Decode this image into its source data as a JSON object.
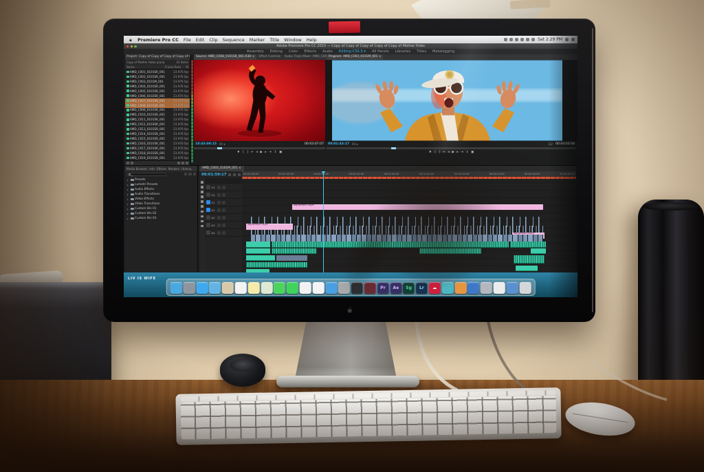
{
  "glyphs": {
    "close": "×",
    "caret": "▾"
  },
  "wallpaper": {
    "text": "LIV IS WIFE"
  },
  "menu_bar": {
    "app_name": "Premiere Pro CC",
    "items": [
      "File",
      "Edit",
      "Clip",
      "Sequence",
      "Marker",
      "Title",
      "Window",
      "Help"
    ],
    "status_icons": [
      "notification-center-icon",
      "bluetooth-icon",
      "airplay-icon",
      "battery-icon",
      "wifi-icon",
      "volume-icon"
    ],
    "clock": "Sat 2:29 PM"
  },
  "window_title": "Adobe Premiere Pro CC 2015 — Copy of Copy of Copy of Copy of Copy of Mother Hobo",
  "workspaces": {
    "tabs": [
      {
        "label": "Assembly"
      },
      {
        "label": "Editing"
      },
      {
        "label": "Color"
      },
      {
        "label": "Effects"
      },
      {
        "label": "Audio"
      },
      {
        "label": "Editing CS5.5 ▾",
        "color": "#35b3e8"
      },
      {
        "label": "All Panels"
      },
      {
        "label": "Libraries"
      },
      {
        "label": "Titles"
      },
      {
        "label": "Metalogging"
      }
    ]
  },
  "project_panel": {
    "tab": "Project: Copy of Copy of Copy of Copy of Copy of Mother Hobo",
    "path": "Copy of Mother Hobo.prproj",
    "item_count": "41 Items",
    "columns": [
      "Name",
      "Frame Rate",
      "M"
    ],
    "rows": [
      {
        "name": "AMD_C001_0101SR_001",
        "fps": "23.976 fps"
      },
      {
        "name": "AMD_C002_0101SR_001",
        "fps": "23.976 fps"
      },
      {
        "name": "AMD_C003_0101M_001",
        "fps": "23.976 fps"
      },
      {
        "name": "AMD_C004_0101SR_001",
        "fps": "23.976 fps"
      },
      {
        "name": "AMD_C005_0101SR_001",
        "fps": "23.976 fps"
      },
      {
        "name": "AMD_C006_0102SR_001",
        "fps": "23.976 fps"
      },
      {
        "name": "AMD_C007_0101SR_001",
        "fps": "23.976 fps",
        "bg": "#a8693a"
      },
      {
        "name": "AMD_C008_0101SR_001",
        "fps": "23.976 fps",
        "bg": "#a8693a"
      },
      {
        "name": "AMD_C009_0101SR_001",
        "fps": "23.976 fps"
      },
      {
        "name": "AMD_C010_0101SR_001",
        "fps": "23.976 fps"
      },
      {
        "name": "AMD_C011_0101SR_001",
        "fps": "23.976 fps"
      },
      {
        "name": "AMD_C012_0103SR_001",
        "fps": "23.976 fps"
      },
      {
        "name": "AMD_C013_0101SR_001",
        "fps": "23.976 fps"
      },
      {
        "name": "AMD_C014_0101SR_001",
        "fps": "23.976 fps"
      },
      {
        "name": "AMD_C015_0101SR_001",
        "fps": "23.976 fps"
      },
      {
        "name": "AMD_C016_0101SR_001",
        "fps": "23.976 fps"
      },
      {
        "name": "AMD_C017_0101SR_001",
        "fps": "23.976 fps"
      },
      {
        "name": "AMD_C018_0101SR_001",
        "fps": "23.976 fps"
      },
      {
        "name": "AMD_C019_0101SR_001",
        "fps": "23.976 fps"
      }
    ]
  },
  "source_monitor": {
    "tab": "Source: AMD_C008_0101SR_001.R3D ×",
    "tab_effects": "Effect Controls",
    "tab_mixer": "Audio Track Mixer: AMD_C003_01",
    "timecode_left": "18:43:08:15",
    "fit": "Fit ▾",
    "timecode_right": "00:03:07:07"
  },
  "program_monitor": {
    "tab": "Program: AMD_C003_0101M_001 ×",
    "timecode_left": "00:01:43:17",
    "fit": "Fit ▾",
    "half": "1/2",
    "timecode_right": "00:04:03:08"
  },
  "transport": {
    "buttons": [
      {
        "glyph": "♦",
        "name": "add-marker-button"
      },
      {
        "glyph": "{",
        "name": "mark-in-button"
      },
      {
        "glyph": "}",
        "name": "mark-out-button"
      },
      {
        "glyph": "⇤",
        "name": "go-to-in-button"
      },
      {
        "glyph": "◂",
        "name": "step-back-button"
      },
      {
        "glyph": "▶",
        "name": "play-button"
      },
      {
        "glyph": "▸",
        "name": "step-forward-button"
      },
      {
        "glyph": "⇥",
        "name": "go-to-out-button"
      },
      {
        "glyph": "↥",
        "name": "lift-button"
      },
      {
        "glyph": "▣",
        "name": "export-frame-button"
      }
    ]
  },
  "bin_panel": {
    "tabs": [
      "Media Browser",
      "Info",
      "Effects",
      "Markers",
      "History"
    ],
    "items": [
      "Presets",
      "Lumetri Presets",
      "Audio Effects",
      "Audio Transitions",
      "Video Effects",
      "Video Transitions",
      "Custom Bin 01",
      "Custom Bin 02",
      "Custom Bin 03"
    ]
  },
  "timeline": {
    "tab": "AMD_C003_0101M_001 ×",
    "timecode": "00:01:59:17",
    "ruler_labels": [
      "00:01:30:00",
      "00:01:45:00",
      "00:02:00:00",
      "00:02:15:00",
      "00:02:30:00",
      "00:02:45:00",
      "00:03:00:00",
      "00:03:15:00",
      "00:03:30:00",
      "00:03:45:00"
    ],
    "adjustment_label": "Adjustment Layer",
    "tools": [
      "selection-tool",
      "track-select-tool",
      "ripple-edit-tool",
      "rolling-edit-tool",
      "rate-stretch-tool",
      "razor-tool",
      "slip-tool",
      "pen-tool",
      "hand-tool",
      "zoom-tool"
    ],
    "tracks": [
      {
        "label": "V3",
        "tbg": "#3f3f3f"
      },
      {
        "label": "V2",
        "tbg": "#3f3f3f"
      },
      {
        "label": "V1",
        "tbg": "#2d8ceb"
      },
      {
        "label": "A1",
        "tbg": "#2d8ceb"
      },
      {
        "label": "A2",
        "tbg": "#3f3f3f"
      },
      {
        "label": "A3",
        "tbg": "#3f3f3f"
      },
      {
        "label": "A4",
        "tbg": "#3f3f3f"
      }
    ]
  },
  "dock": {
    "icons": [
      {
        "name": "finder-icon",
        "bg": "#4aa8e0"
      },
      {
        "name": "launchpad-icon",
        "bg": "#8f959e"
      },
      {
        "name": "safari-icon",
        "bg": "#3fa9f0"
      },
      {
        "name": "mail-icon",
        "bg": "#63b4e4"
      },
      {
        "name": "contacts-icon",
        "bg": "#d9c9a8"
      },
      {
        "name": "calendar-icon",
        "bg": "#f4f3f1"
      },
      {
        "name": "notes-icon",
        "bg": "#f7eaa8"
      },
      {
        "name": "maps-icon",
        "bg": "#dfe8d2"
      },
      {
        "name": "messages-icon",
        "bg": "#4cd35e"
      },
      {
        "name": "facetime-icon",
        "bg": "#3fd35b"
      },
      {
        "name": "photos-icon",
        "bg": "#f2f2f2"
      },
      {
        "name": "itunes-icon",
        "bg": "#f4f4f6"
      },
      {
        "name": "app-store-icon",
        "bg": "#4a9fe0"
      },
      {
        "name": "system-preferences-icon",
        "bg": "#a7a9ad"
      },
      {
        "name": "quicktime-icon",
        "bg": "#2e2f33"
      },
      {
        "name": "color-wheel-icon",
        "bg": "#6a2a33"
      },
      {
        "name": "premiere-icon",
        "bg": "#372f63",
        "glyph": "Pr",
        "fg": "#cdb6f7"
      },
      {
        "name": "after-effects-icon",
        "bg": "#372f63",
        "glyph": "Ae",
        "fg": "#cdb6f7"
      },
      {
        "name": "speedgrade-icon",
        "bg": "#123f33",
        "glyph": "Sg",
        "fg": "#57d8a6"
      },
      {
        "name": "lightroom-icon",
        "bg": "#16324f",
        "glyph": "Lr",
        "fg": "#9fd0f2"
      },
      {
        "name": "creative-cloud-icon",
        "bg": "#d1203c",
        "glyph": "☁",
        "fg": "#ffffff"
      },
      {
        "name": "airplay-display-icon",
        "bg": "#4db6c2"
      },
      {
        "name": "downloads-folder-icon",
        "bg": "#e8953f"
      },
      {
        "name": "globe-icon",
        "bg": "#3f78c9"
      },
      {
        "name": "gear-utility-icon",
        "bg": "#b4b8be"
      },
      {
        "name": "text-edit-icon",
        "bg": "#ececec"
      },
      {
        "name": "folder-icon",
        "bg": "#5a8fd0"
      },
      {
        "name": "trash-icon",
        "bg": "#d4d6d9"
      }
    ]
  }
}
